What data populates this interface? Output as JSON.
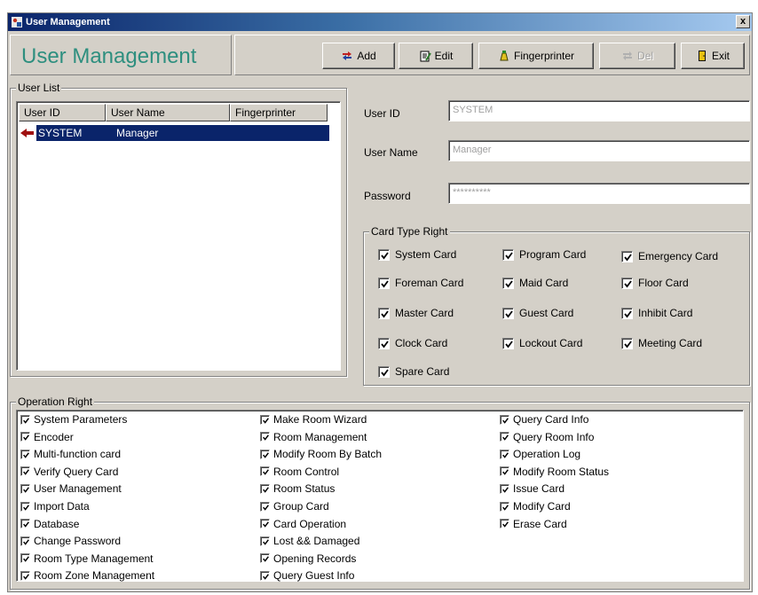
{
  "window": {
    "title": "User Management",
    "close_glyph": "x"
  },
  "header": {
    "title": "User Management"
  },
  "toolbar": {
    "add": {
      "label": "Add",
      "icon": "add-user-icon"
    },
    "edit": {
      "label": "Edit",
      "icon": "edit-icon"
    },
    "fingerprinter": {
      "label": "Fingerprinter",
      "icon": "fingerprint-icon"
    },
    "delete": {
      "label": "Del",
      "icon": "delete-icon",
      "disabled": true
    },
    "exit": {
      "label": "Exit",
      "icon": "exit-door-icon"
    }
  },
  "user_list": {
    "legend": "User List",
    "columns": [
      "User ID",
      "User Name",
      "Fingerprinter"
    ],
    "rows": [
      {
        "user_id": "SYSTEM",
        "user_name": "Manager",
        "fingerprinter": "",
        "selected": true
      }
    ]
  },
  "form": {
    "user_id": {
      "label": "User ID",
      "value": "SYSTEM"
    },
    "user_name": {
      "label": "User Name",
      "value": "Manager"
    },
    "password": {
      "label": "Password",
      "value": "**********"
    }
  },
  "card_type_right": {
    "legend": "Card Type Right",
    "items": [
      {
        "label": "System Card",
        "checked": true
      },
      {
        "label": "Program Card",
        "checked": true
      },
      {
        "label": "Emergency Card",
        "checked": true
      },
      {
        "label": "Foreman Card",
        "checked": true
      },
      {
        "label": "Maid Card",
        "checked": true
      },
      {
        "label": "Floor Card",
        "checked": true
      },
      {
        "label": "Master Card",
        "checked": true
      },
      {
        "label": "Guest Card",
        "checked": true
      },
      {
        "label": "Inhibit Card",
        "checked": true
      },
      {
        "label": "Clock Card",
        "checked": true
      },
      {
        "label": "Lockout Card",
        "checked": true
      },
      {
        "label": "Meeting Card",
        "checked": true
      },
      {
        "label": "Spare Card",
        "checked": true
      }
    ]
  },
  "operation_right": {
    "legend": "Operation Right",
    "columns": [
      [
        "System Parameters",
        "Encoder",
        "Multi-function card",
        "Verify Query Card",
        "User Management",
        "Import Data",
        "Database",
        "Change Password",
        "Room Type Management",
        "Room Zone Management"
      ],
      [
        "Make Room Wizard",
        "Room Management",
        "Modify Room By Batch",
        "Room Control",
        "Room Status",
        "Group Card",
        "Card Operation",
        "Lost && Damaged",
        "Opening Records",
        "Query Guest Info"
      ],
      [
        "Query Card Info",
        "Query Room Info",
        "Operation Log",
        "Modify Room Status",
        "Issue Card",
        "Modify Card",
        "Erase Card"
      ]
    ]
  },
  "colors": {
    "title_accent": "#2e8f7f",
    "selection": "#0a246a",
    "face": "#d4d0c8"
  }
}
